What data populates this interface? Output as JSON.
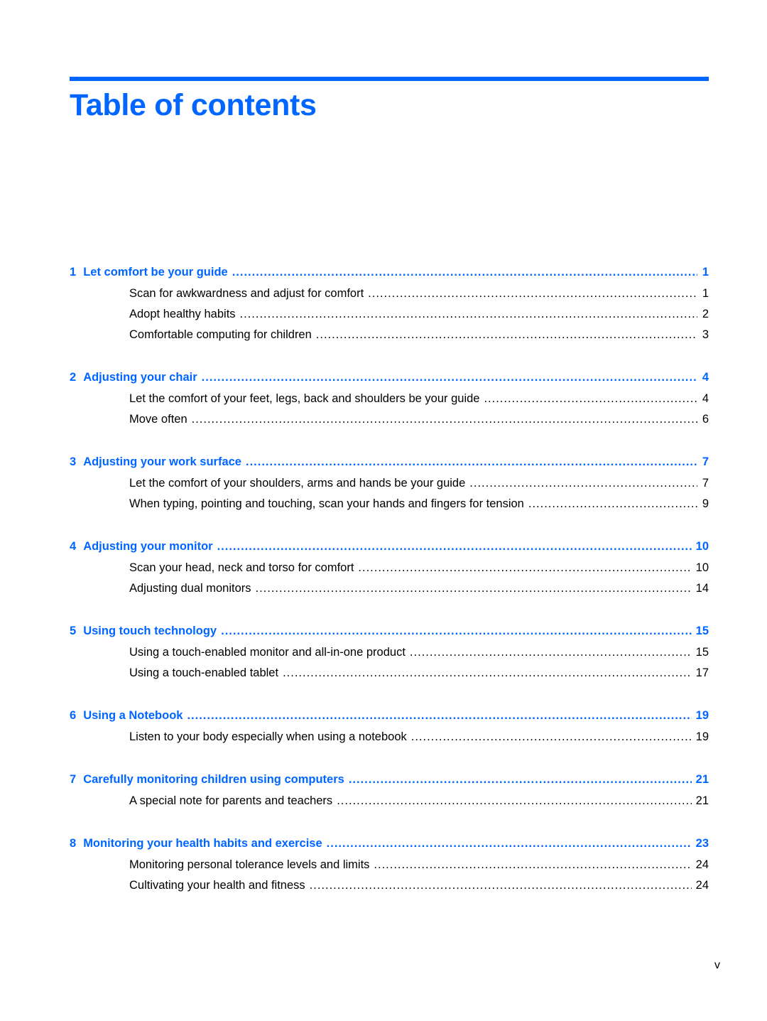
{
  "page": {
    "title": "Table of contents",
    "folio": "v",
    "accent_color": "#0066ff"
  },
  "toc": [
    {
      "number": "1",
      "title": "Let comfort be your guide",
      "page": "1",
      "sections": [
        {
          "title": "Scan for awkwardness and adjust for comfort",
          "page": "1"
        },
        {
          "title": "Adopt healthy habits",
          "page": "2"
        },
        {
          "title": "Comfortable computing for children",
          "page": "3"
        }
      ]
    },
    {
      "number": "2",
      "title": "Adjusting your chair",
      "page": "4",
      "sections": [
        {
          "title": "Let the comfort of your feet, legs, back and shoulders be your guide",
          "page": "4"
        },
        {
          "title": "Move often",
          "page": "6"
        }
      ]
    },
    {
      "number": "3",
      "title": "Adjusting your work surface",
      "page": "7",
      "sections": [
        {
          "title": "Let the comfort of your shoulders, arms and hands be your guide",
          "page": "7"
        },
        {
          "title": "When typing, pointing and touching, scan your hands and fingers for tension",
          "page": "9"
        }
      ]
    },
    {
      "number": "4",
      "title": "Adjusting your monitor",
      "page": "10",
      "sections": [
        {
          "title": "Scan your head, neck and torso for comfort",
          "page": "10"
        },
        {
          "title": "Adjusting dual monitors",
          "page": "14"
        }
      ]
    },
    {
      "number": "5",
      "title": "Using touch technology",
      "page": "15",
      "sections": [
        {
          "title": "Using a touch-enabled monitor and all-in-one product",
          "page": "15"
        },
        {
          "title": "Using a touch-enabled tablet",
          "page": "17"
        }
      ]
    },
    {
      "number": "6",
      "title": "Using a Notebook",
      "page": "19",
      "sections": [
        {
          "title": "Listen to your body especially when using a notebook",
          "page": "19"
        }
      ]
    },
    {
      "number": "7",
      "title": "Carefully monitoring children using computers",
      "page": "21",
      "sections": [
        {
          "title": "A special note for parents and teachers",
          "page": "21"
        }
      ]
    },
    {
      "number": "8",
      "title": "Monitoring your health habits and exercise",
      "page": "23",
      "sections": [
        {
          "title": "Monitoring personal tolerance levels and limits",
          "page": "24"
        },
        {
          "title": "Cultivating your health and fitness",
          "page": "24"
        }
      ]
    }
  ]
}
